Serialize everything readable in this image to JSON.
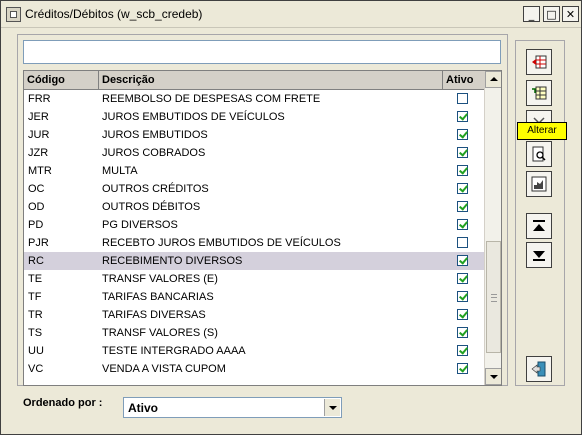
{
  "window": {
    "title": "Créditos/Débitos (w_scb_credeb)"
  },
  "search": {
    "value": ""
  },
  "grid": {
    "columns": [
      "Código",
      "Descrição",
      "Ativo"
    ],
    "rows": [
      {
        "code": "FRR",
        "desc": "REEMBOLSO DE DESPESAS COM FRETE",
        "active": false
      },
      {
        "code": "JER",
        "desc": "JUROS EMBUTIDOS DE VEÍCULOS",
        "active": true
      },
      {
        "code": "JUR",
        "desc": "JUROS EMBUTIDOS",
        "active": true
      },
      {
        "code": "JZR",
        "desc": "JUROS COBRADOS",
        "active": true
      },
      {
        "code": "MTR",
        "desc": "MULTA",
        "active": true
      },
      {
        "code": "OC",
        "desc": "OUTROS CRÉDITOS",
        "active": true
      },
      {
        "code": "OD",
        "desc": "OUTROS DÉBITOS",
        "active": true
      },
      {
        "code": "PD",
        "desc": "PG DIVERSOS",
        "active": true
      },
      {
        "code": "PJR",
        "desc": "RECEBTO JUROS EMBUTIDOS DE VEÍCULOS",
        "active": false
      },
      {
        "code": "RC",
        "desc": "RECEBIMENTO DIVERSOS",
        "active": true,
        "selected": true
      },
      {
        "code": "TE",
        "desc": "TRANSF VALORES (E)",
        "active": true
      },
      {
        "code": "TF",
        "desc": "TARIFAS BANCARIAS",
        "active": true
      },
      {
        "code": "TR",
        "desc": "TARIFAS DIVERSAS",
        "active": true
      },
      {
        "code": "TS",
        "desc": "TRANSF VALORES (S)",
        "active": true
      },
      {
        "code": "UU",
        "desc": "TESTE INTERGRADO AAAA",
        "active": true
      },
      {
        "code": "VC",
        "desc": "VENDA A VISTA CUPOM",
        "active": true
      }
    ]
  },
  "toolbar": {
    "tooltip": "Alterar"
  },
  "order": {
    "label": "Ordenado por :",
    "value": "Ativo"
  }
}
